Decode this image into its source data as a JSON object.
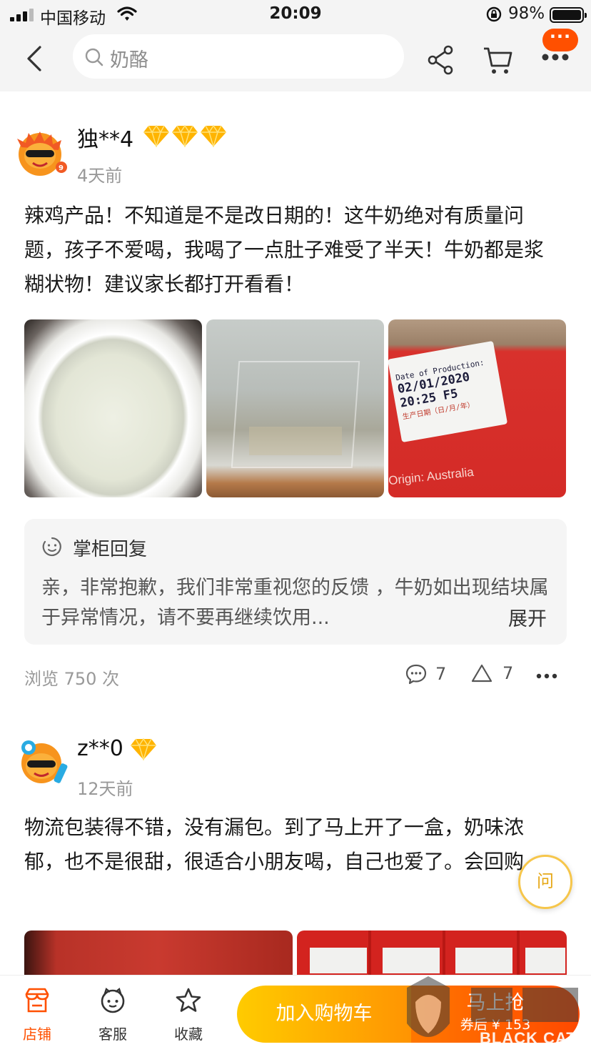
{
  "status_bar": {
    "carrier": "中国移动",
    "time": "20:09",
    "battery": "98%"
  },
  "header": {
    "search_placeholder": "奶酪",
    "more_badge": "···"
  },
  "reviews": [
    {
      "username": "独**4",
      "diamonds": 3,
      "date": "4天前",
      "content": "辣鸡产品！不知道是不是改日期的！这牛奶绝对有质量问题，孩子不爱喝，我喝了一点肚子难受了半天！牛奶都是浆糊状物！建议家长都打开看看！",
      "photo3_text": {
        "line1": "Date of Production:",
        "line2": "02/01/2020",
        "line3": "20:25  F5",
        "line4": "生产日期（日/月/年）",
        "line5": "Origin: Australia"
      },
      "reply": {
        "title": "掌柜回复",
        "text": "亲，非常抱歉，我们非常重视您的反馈 ，牛奶如出现结块属于异常情况，请不要再继续饮用...",
        "expand": "展开"
      },
      "views": "浏览 750 次",
      "comments": "7",
      "likes": "7"
    },
    {
      "username": "z**0",
      "diamonds": 1,
      "date": "12天前",
      "content": "物流包装得不错，没有漏包。到了马上开了一盒，奶味浓郁，也不是很甜，很适合小朋友喝，自己也爱了。会回购。"
    }
  ],
  "ask_button": "问",
  "bottom_bar": {
    "tabs": [
      {
        "label": "店铺"
      },
      {
        "label": "客服"
      },
      {
        "label": "收藏"
      }
    ],
    "add_to_cart": "加入购物车",
    "buy_now": "马上抢",
    "coupon_price": "券后 ¥ 153"
  },
  "watermark": "BLACK CAT",
  "colors": {
    "accent": "#ff5000",
    "cart_button": "#ffa800",
    "buy_button": "#ff5a00"
  }
}
